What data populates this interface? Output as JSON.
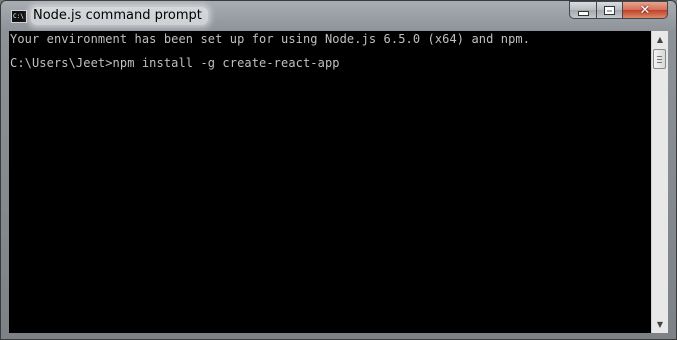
{
  "window": {
    "title": "Node.js command prompt",
    "icon_name": "console-icon",
    "icon_text": "C:\\"
  },
  "controls": {
    "minimize_icon": "minimize-icon",
    "maximize_icon": "maximize-icon",
    "close_icon": "close-icon",
    "close_glyph": "✕"
  },
  "console": {
    "background": "#000000",
    "foreground": "#c0c0c0",
    "lines": [
      "Your environment has been set up for using Node.js 6.5.0 (x64) and npm.",
      "C:\\Users\\Jeet>npm install -g create-react-app"
    ]
  },
  "scrollbar": {
    "up_glyph": "▲",
    "down_glyph": "▼"
  }
}
